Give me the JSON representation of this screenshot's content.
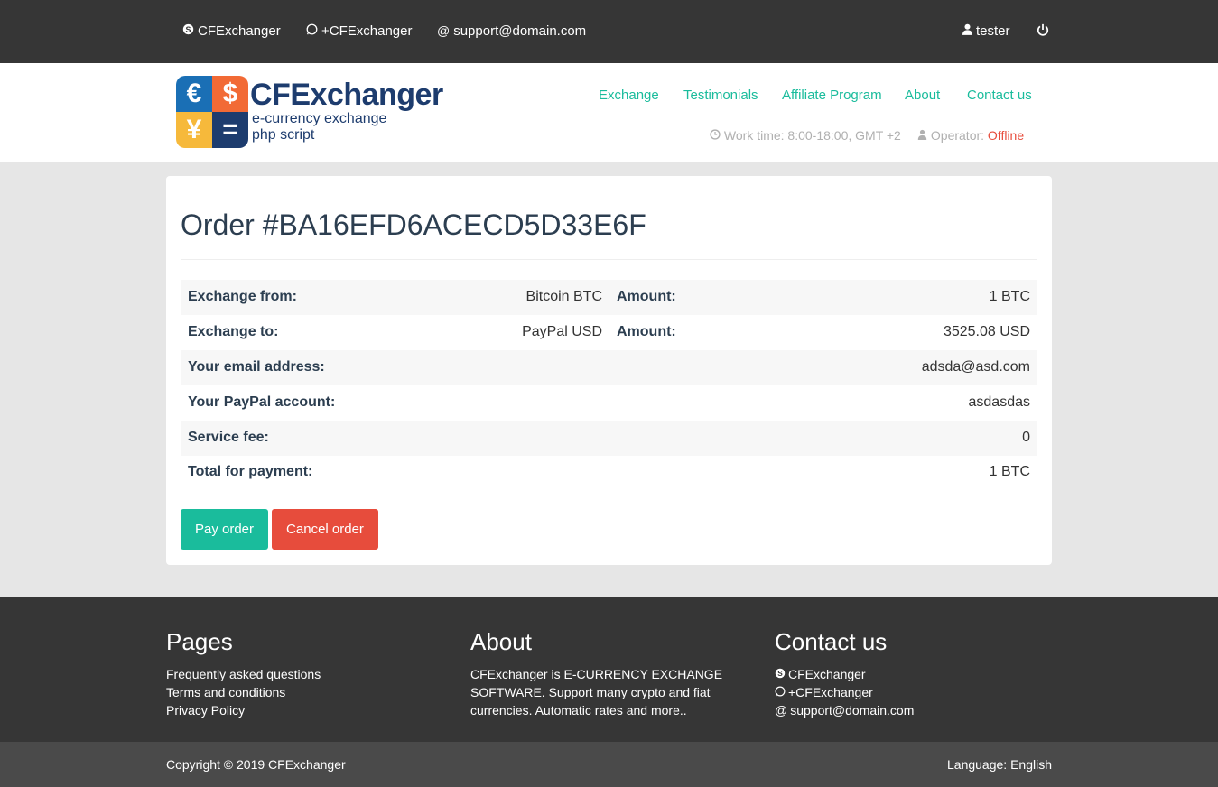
{
  "topbar": {
    "skype": "CFExchanger",
    "whatsapp": "+CFExchanger",
    "email": "support@domain.com",
    "user": "tester",
    "icons": {
      "skype": "skype-icon",
      "whatsapp": "whatsapp-icon",
      "email": "at-icon",
      "user": "user-icon",
      "logout": "power-icon"
    }
  },
  "logo": {
    "title": "CFExchanger",
    "sub1": "e-currency exchange",
    "sub2": "php script",
    "glyphs": [
      "€",
      "$",
      "¥",
      "="
    ],
    "colors": [
      "#1a6fb5",
      "#f26a35",
      "#f6b93b",
      "#1d3c6e"
    ]
  },
  "nav": {
    "items": [
      "Exchange",
      "Testimonials",
      "Affiliate Program",
      "About",
      "Contact us"
    ]
  },
  "status": {
    "worktime_label": "Work time: 8:00-18:00, GMT +2",
    "operator_label": "Operator:",
    "operator_status": "Offline"
  },
  "order": {
    "title": "Order #BA16EFD6ACECD5D33E6F",
    "rows": [
      {
        "label": "Exchange from:",
        "mid": "Bitcoin BTC",
        "label2": "Amount:",
        "value": "1 BTC"
      },
      {
        "label": "Exchange to:",
        "mid": "PayPal USD",
        "label2": "Amount:",
        "value": "3525.08 USD"
      },
      {
        "label": "Your email address:",
        "value": "adsda@asd.com"
      },
      {
        "label": "Your PayPal account:",
        "value": "asdasdas"
      },
      {
        "label": "Service fee:",
        "value": "0"
      },
      {
        "label": "Total for payment:",
        "value": "1 BTC"
      }
    ],
    "pay_button": "Pay order",
    "cancel_button": "Cancel order"
  },
  "footer": {
    "pages_title": "Pages",
    "pages": [
      "Frequently asked questions",
      "Terms and conditions",
      "Privacy Policy"
    ],
    "about_title": "About",
    "about_text": "CFExchanger is E-CURRENCY EXCHANGE SOFTWARE. Support many crypto and fiat currencies. Automatic rates and more..",
    "contact_title": "Contact us",
    "contact_skype": "CFExchanger",
    "contact_whatsapp": "+CFExchanger",
    "contact_email": "support@domain.com"
  },
  "bottom": {
    "copyright": "Copyright © 2019 CFExchanger",
    "language": "Language: English"
  },
  "colors": {
    "accent": "#1abc9c",
    "danger": "#e74c3c",
    "dark": "#363636",
    "navy": "#1d3c6e"
  }
}
